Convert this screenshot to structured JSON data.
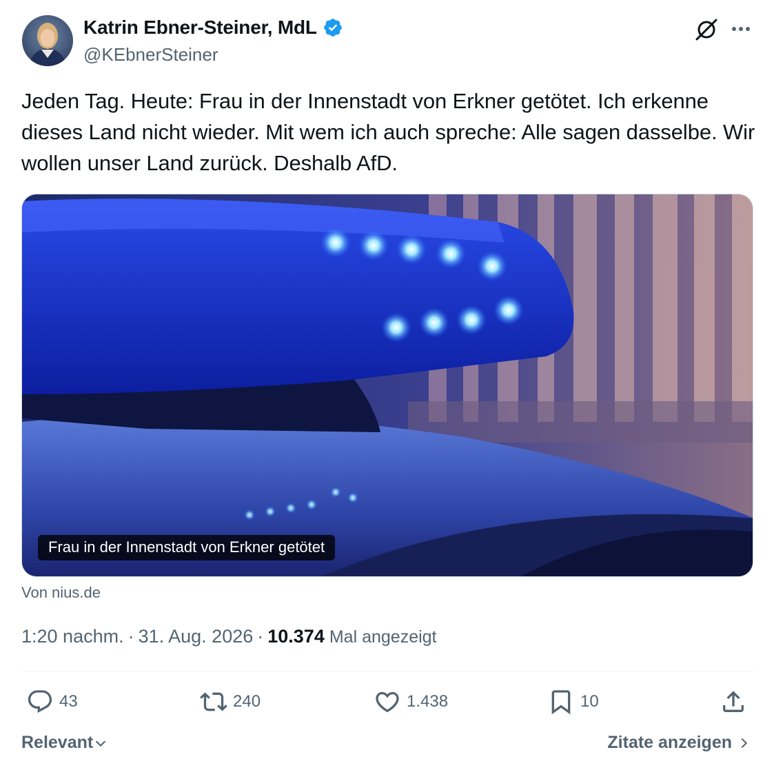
{
  "author": {
    "name": "Katrin Ebner-Steiner, MdL",
    "handle": "@KEbnerSteiner",
    "verified": true
  },
  "tweet": {
    "text": "Jeden Tag. Heute: Frau in der Innenstadt von Erkner getötet. Ich erkenne dieses Land nicht wieder. Mit wem ich auch spreche: Alle sagen dasselbe. Wir wollen unser Land zurück. Deshalb AfD.",
    "card_caption": "Frau in der Innenstadt von Erkner getötet",
    "source": "Von nius.de",
    "time": "1:20 nachm.",
    "separator": "·",
    "date": "31. Aug. 2026",
    "views": "10.374",
    "views_label": "Mal angezeigt"
  },
  "actions": {
    "replies": "43",
    "reposts": "240",
    "likes": "1.438",
    "bookmarks": "10"
  },
  "footer": {
    "sort_label": "Relevant",
    "quotes_label": "Zitate anzeigen"
  },
  "colors": {
    "text": "#0f1419",
    "secondary": "#536471",
    "verified_blue": "#1d9bf0",
    "divider": "#eff3f4"
  },
  "icons": [
    "verified-badge-icon",
    "grok-icon",
    "more-icon",
    "reply-icon",
    "repost-icon",
    "like-icon",
    "bookmark-icon",
    "share-icon",
    "chevron-down-icon",
    "chevron-right-icon"
  ]
}
